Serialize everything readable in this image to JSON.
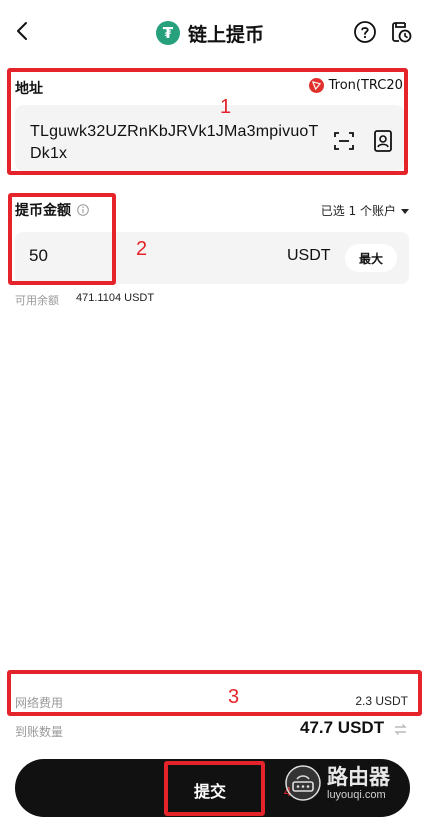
{
  "header": {
    "title": "链上提币",
    "coin_icon_letter": "₮",
    "icons": [
      "back-arrow-icon",
      "help-icon",
      "history-icon"
    ]
  },
  "address": {
    "label": "地址",
    "network": "Tron(TRC20)",
    "value": "TLguwk32UZRnKbJRVk1JMa3mpivuoTDk1x"
  },
  "amount": {
    "label": "提币金额",
    "account_selector": "已选 1 个账户",
    "value": "50",
    "unit": "USDT",
    "max_label": "最大",
    "available_label": "可用余额",
    "available_value": "471.1104 USDT"
  },
  "fees": {
    "network_fee_label": "网络费用",
    "network_fee_value": "2.3 USDT",
    "receive_label": "到账数量",
    "receive_value": "47.7 USDT"
  },
  "submit": {
    "label": "提交"
  },
  "annotations": [
    "1",
    "2",
    "3",
    "4"
  ],
  "watermark": {
    "cn": "路由器",
    "en": "luyouqi.com"
  },
  "colors": {
    "accent_red": "#e4242a",
    "tether_green": "#26a17b",
    "tron_red": "#e0302c",
    "submit_bg": "#111111"
  }
}
